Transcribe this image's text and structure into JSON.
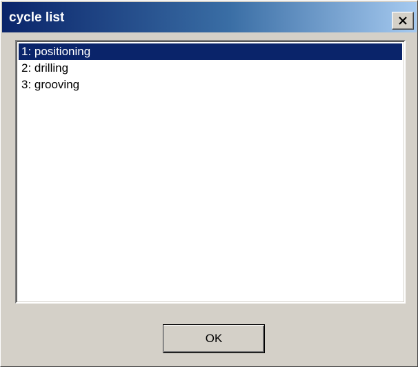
{
  "window": {
    "title": "cycle list",
    "close_label": "Close"
  },
  "cycle_list": {
    "selected_index": 0,
    "items": [
      {
        "label": "1: positioning"
      },
      {
        "label": "2: drilling"
      },
      {
        "label": "3: grooving"
      }
    ]
  },
  "buttons": {
    "ok_label": "OK"
  },
  "icons": {
    "close": "close-icon"
  },
  "colors": {
    "titlebar_start": "#0a246a",
    "titlebar_end": "#a6caf0",
    "selection": "#0a246a",
    "face": "#d4d0c8"
  }
}
